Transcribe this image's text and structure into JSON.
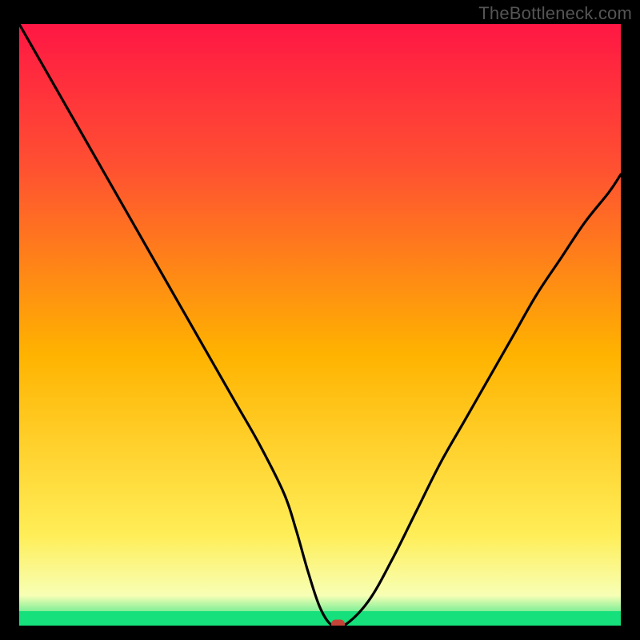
{
  "watermark": "TheBottleneck.com",
  "colors": {
    "top": "#ff1744",
    "upper": "#ff5131",
    "mid": "#ffb300",
    "lower": "#ffee58",
    "pale": "#f7ffb5",
    "green": "#15e07c",
    "curve": "#000000",
    "marker": "#c44538",
    "background": "#000000"
  },
  "chart_data": {
    "type": "line",
    "title": "",
    "xlabel": "",
    "ylabel": "",
    "xlim": [
      0,
      100
    ],
    "ylim": [
      0,
      100
    ],
    "grid": false,
    "legend": false,
    "series": [
      {
        "name": "bottleneck-curve",
        "x": [
          0,
          4,
          8,
          12,
          16,
          20,
          24,
          28,
          32,
          36,
          40,
          44,
          46,
          48,
          50,
          52,
          54,
          58,
          62,
          66,
          70,
          74,
          78,
          82,
          86,
          90,
          94,
          98,
          100
        ],
        "y": [
          100,
          93,
          86,
          79,
          72,
          65,
          58,
          51,
          44,
          37,
          30,
          22,
          16,
          9,
          3,
          0,
          0,
          4,
          11,
          19,
          27,
          34,
          41,
          48,
          55,
          61,
          67,
          72,
          75
        ]
      }
    ],
    "marker": {
      "x": 53,
      "y": 0
    },
    "bands": [
      {
        "y0": 0,
        "y1": 2.5,
        "color": "#15e07c"
      },
      {
        "y0": 2.5,
        "y1": 8,
        "color": "#f7ffb5"
      },
      {
        "y0": 8,
        "y1": 20,
        "color": "#ffee58"
      },
      {
        "y0": 20,
        "y1": 55,
        "color": "#ffb300"
      },
      {
        "y0": 55,
        "y1": 80,
        "color": "#ff5131"
      },
      {
        "y0": 80,
        "y1": 100,
        "color": "#ff1744"
      }
    ]
  }
}
